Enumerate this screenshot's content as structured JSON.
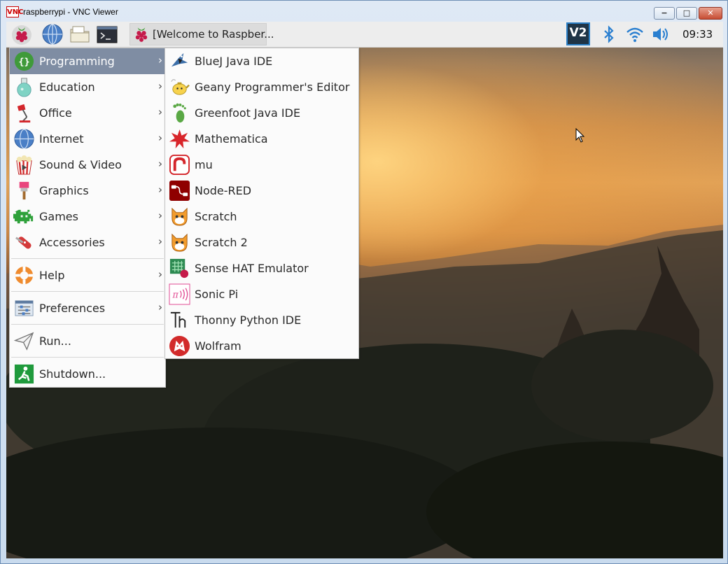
{
  "window": {
    "app_icon": "VNC",
    "title": "raspberrypi - VNC Viewer",
    "controls": {
      "minimize": "−",
      "maximize": "□",
      "close": "✕"
    }
  },
  "taskbar": {
    "launchers": [
      "raspberry-menu-icon",
      "web-browser-icon",
      "file-manager-icon",
      "terminal-icon"
    ],
    "window_button_label": "[Welcome to Raspber...",
    "tray": {
      "vnc_label": "V2",
      "icons": [
        "bluetooth-icon",
        "wifi-icon",
        "volume-icon"
      ],
      "clock": "09:33"
    }
  },
  "main_menu": {
    "items": [
      {
        "label": "Programming",
        "icon": "braces-icon",
        "has_submenu": true
      },
      {
        "label": "Education",
        "icon": "flask-icon",
        "has_submenu": true
      },
      {
        "label": "Office",
        "icon": "desk-lamp-icon",
        "has_submenu": true
      },
      {
        "label": "Internet",
        "icon": "globe-icon",
        "has_submenu": true
      },
      {
        "label": "Sound & Video",
        "icon": "popcorn-icon",
        "has_submenu": true
      },
      {
        "label": "Graphics",
        "icon": "paintbrush-icon",
        "has_submenu": true
      },
      {
        "label": "Games",
        "icon": "space-invader-icon",
        "has_submenu": true
      },
      {
        "label": "Accessories",
        "icon": "swiss-knife-icon",
        "has_submenu": true
      },
      {
        "label": "Help",
        "icon": "lifebuoy-icon",
        "has_submenu": true
      },
      {
        "label": "Preferences",
        "icon": "sliders-icon",
        "has_submenu": true
      },
      {
        "label": "Run...",
        "icon": "paper-plane-icon",
        "has_submenu": false
      },
      {
        "label": "Shutdown...",
        "icon": "exit-icon",
        "has_submenu": false
      }
    ],
    "arrow": "›",
    "active_index": 0
  },
  "programming_submenu": {
    "items": [
      {
        "label": "BlueJ Java IDE",
        "icon": "bluej-bird-icon"
      },
      {
        "label": "Geany Programmer's Editor",
        "icon": "geany-teapot-icon"
      },
      {
        "label": "Greenfoot Java IDE",
        "icon": "greenfoot-footprint-icon"
      },
      {
        "label": "Mathematica",
        "icon": "mathematica-star-icon"
      },
      {
        "label": "mu",
        "icon": "mu-snake-icon"
      },
      {
        "label": "Node-RED",
        "icon": "node-red-icon"
      },
      {
        "label": "Scratch",
        "icon": "scratch-cat-icon"
      },
      {
        "label": "Scratch 2",
        "icon": "scratch-cat-icon"
      },
      {
        "label": "Sense HAT Emulator",
        "icon": "sense-hat-icon"
      },
      {
        "label": "Sonic Pi",
        "icon": "sonic-pi-icon"
      },
      {
        "label": "Thonny Python IDE",
        "icon": "thonny-icon"
      },
      {
        "label": "Wolfram",
        "icon": "wolfram-wolf-icon"
      }
    ]
  },
  "colors": {
    "menu_highlight": "#7f8da3",
    "taskbar": "#ededed",
    "raspberry": "#c51a4a"
  }
}
